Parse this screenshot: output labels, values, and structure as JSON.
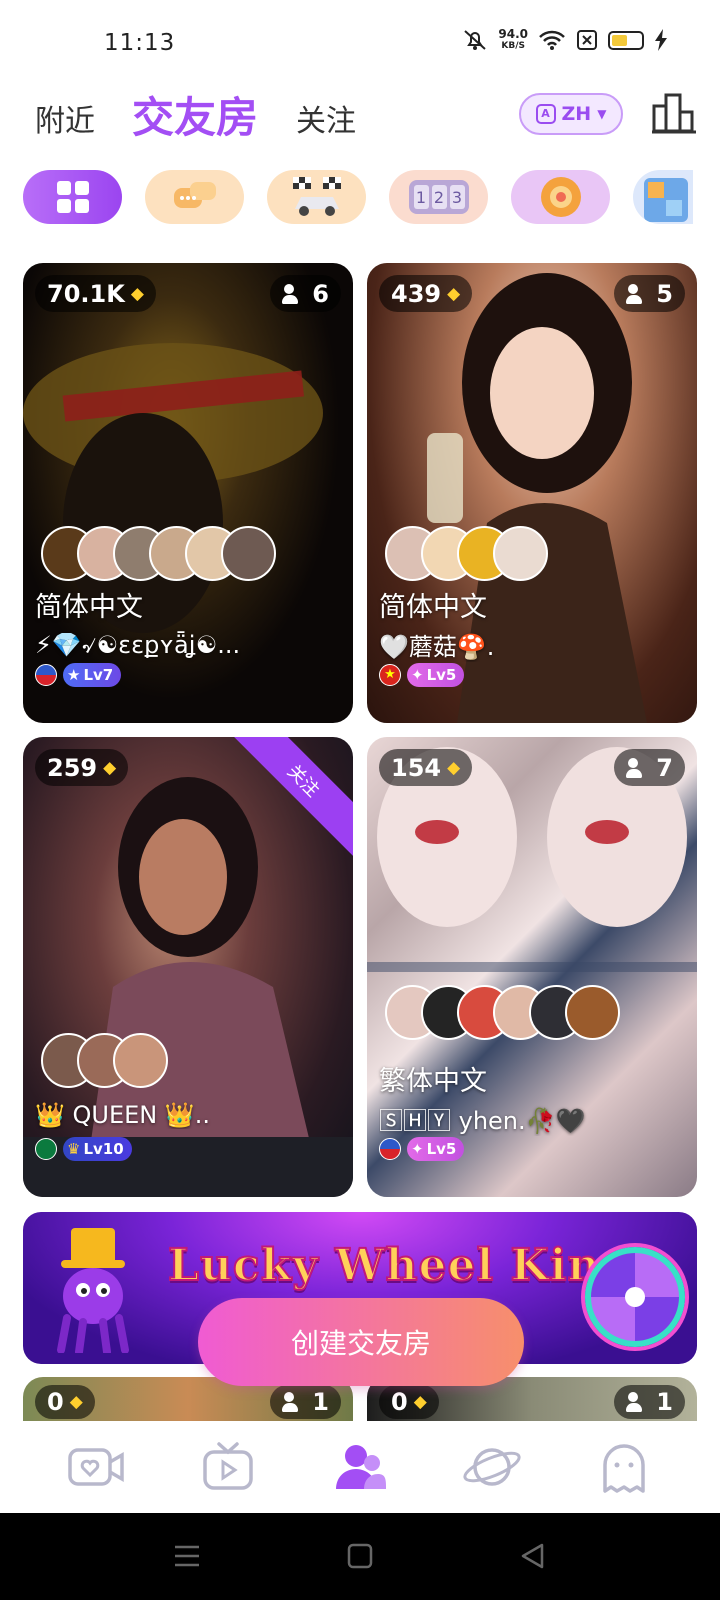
{
  "status_bar": {
    "time": "11:13",
    "net_speed": "94.0",
    "net_unit": "KB/S",
    "battery_level": 0.55
  },
  "header": {
    "tabs": [
      {
        "label": "附近",
        "active": false
      },
      {
        "label": "交友房",
        "active": true
      },
      {
        "label": "关注",
        "active": false
      }
    ],
    "language": "ZH",
    "colors": {
      "accent": "#a34ef4"
    }
  },
  "categories": [
    {
      "icon": "grid-icon",
      "selected": true
    },
    {
      "icon": "chat-bubbles-icon",
      "selected": false
    },
    {
      "icon": "race-car-icon",
      "selected": false
    },
    {
      "icon": "number-slot-icon",
      "selected": false
    },
    {
      "icon": "spin-ball-icon",
      "selected": false
    },
    {
      "icon": "number-cube-icon",
      "selected": false
    }
  ],
  "rooms": [
    {
      "diamonds": "70.1K",
      "users": "6",
      "name": "简体中文",
      "owner": "⚡💎৵☯ɛɛքʏǟʝ☯...",
      "flag_icon": "philippines-flag-icon",
      "level": "Lv7",
      "followed": false
    },
    {
      "diamonds": "439",
      "users": "5",
      "name": "简体中文",
      "owner": "🤍蘑菇🍄.",
      "flag_icon": "vietnam-flag-icon",
      "level": "Lv5",
      "followed": false
    },
    {
      "diamonds": "259",
      "users": "",
      "name": "",
      "owner": "👑 QUEEN 👑..",
      "flag_icon": "saudi-arabia-flag-icon",
      "level": "Lv10",
      "followed": true,
      "follow_label": "关注"
    },
    {
      "diamonds": "154",
      "users": "7",
      "name": "繁体中文",
      "owner": "🅂🄷🅈 yhen.🥀🖤",
      "flag_icon": "philippines-flag-icon",
      "level": "Lv5",
      "followed": false
    },
    {
      "diamonds": "0",
      "users": "1"
    },
    {
      "diamonds": "0",
      "users": "1"
    }
  ],
  "banner": {
    "title": "Lucky Wheel King"
  },
  "create_button": "创建交友房",
  "bottom_nav": [
    {
      "icon": "video-heart-icon",
      "active": false
    },
    {
      "icon": "tv-play-icon",
      "active": false
    },
    {
      "icon": "party-users-icon",
      "active": true
    },
    {
      "icon": "planet-icon",
      "active": false
    },
    {
      "icon": "ghost-chat-icon",
      "active": false
    }
  ]
}
